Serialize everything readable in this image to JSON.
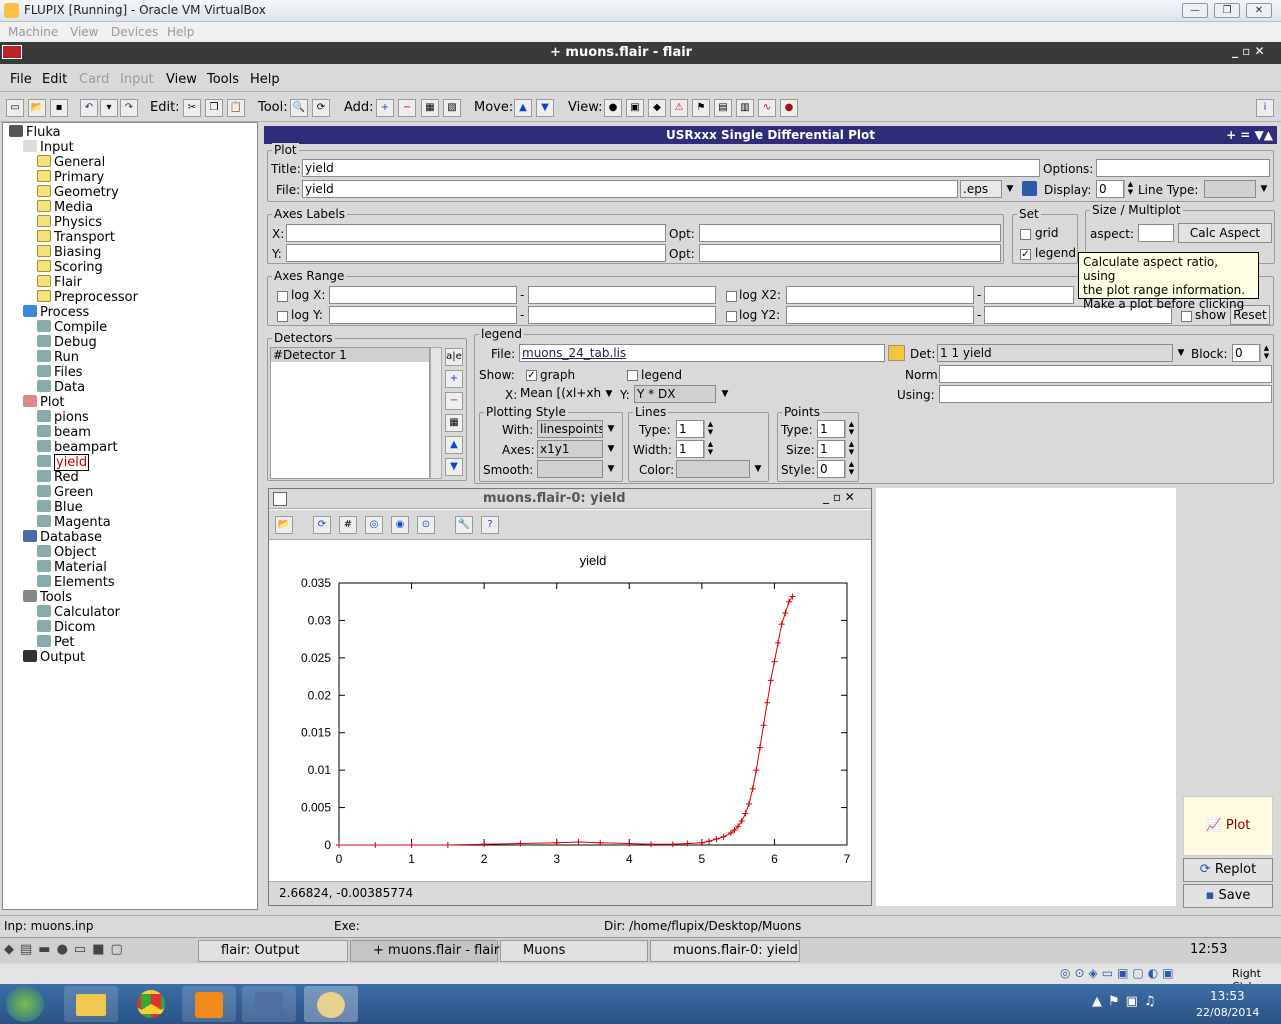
{
  "host": {
    "title": "FLUPIX [Running] - Oracle VM VirtualBox",
    "menu": [
      "Machine",
      "View",
      "Devices",
      "Help"
    ]
  },
  "flair": {
    "title": "+ muons.flair - flair",
    "menu": [
      "File",
      "Edit",
      "Card",
      "Input",
      "View",
      "Tools",
      "Help"
    ],
    "toolbar": {
      "edit": "Edit:",
      "tool": "Tool:",
      "add": "Add:",
      "move": "Move:",
      "view": "View:"
    }
  },
  "tree": {
    "items": [
      {
        "label": "Fluka",
        "indent": 0
      },
      {
        "label": "Input",
        "indent": 1
      },
      {
        "label": "General",
        "indent": 2
      },
      {
        "label": "Primary",
        "indent": 2
      },
      {
        "label": "Geometry",
        "indent": 2
      },
      {
        "label": "Media",
        "indent": 2
      },
      {
        "label": "Physics",
        "indent": 2
      },
      {
        "label": "Transport",
        "indent": 2
      },
      {
        "label": "Biasing",
        "indent": 2
      },
      {
        "label": "Scoring",
        "indent": 2
      },
      {
        "label": "Flair",
        "indent": 2
      },
      {
        "label": "Preprocessor",
        "indent": 2
      },
      {
        "label": "Process",
        "indent": 1
      },
      {
        "label": "Compile",
        "indent": 2
      },
      {
        "label": "Debug",
        "indent": 2
      },
      {
        "label": "Run",
        "indent": 2
      },
      {
        "label": "Files",
        "indent": 2
      },
      {
        "label": "Data",
        "indent": 2
      },
      {
        "label": "Plot",
        "indent": 1
      },
      {
        "label": "pions",
        "indent": 2
      },
      {
        "label": "beam",
        "indent": 2
      },
      {
        "label": "beampart",
        "indent": 2
      },
      {
        "label": "yield",
        "indent": 2
      },
      {
        "label": "Red",
        "indent": 2
      },
      {
        "label": "Green",
        "indent": 2
      },
      {
        "label": "Blue",
        "indent": 2
      },
      {
        "label": "Magenta",
        "indent": 2
      },
      {
        "label": "Database",
        "indent": 1
      },
      {
        "label": "Object",
        "indent": 2
      },
      {
        "label": "Material",
        "indent": 2
      },
      {
        "label": "Elements",
        "indent": 2
      },
      {
        "label": "Tools",
        "indent": 1
      },
      {
        "label": "Calculator",
        "indent": 2
      },
      {
        "label": "Dicom",
        "indent": 2
      },
      {
        "label": "Pet",
        "indent": 2
      },
      {
        "label": "Output",
        "indent": 1
      }
    ]
  },
  "panel": {
    "header": "USRxxx Single Differential Plot",
    "header_ctrls": "+ = ▼▲",
    "plot": {
      "legend": "Plot",
      "title_label": "Title:",
      "title": "yield",
      "options_label": "Options:",
      "file_label": "File:",
      "file": "yield",
      "ext": ".eps",
      "display_label": "Display:",
      "display": "0",
      "linetype_label": "Line Type:"
    },
    "axes_labels": {
      "legend": "Axes Labels",
      "x": "X:",
      "y": "Y:",
      "opt": "Opt:"
    },
    "set": {
      "legend": "Set",
      "grid": "grid",
      "legend_chk": "legend"
    },
    "size": {
      "legend": "Size / Multiplot",
      "aspect": "aspect:",
      "calc": "Calc Aspect"
    },
    "tooltip": [
      "Calculate aspect ratio, using",
      "the plot range information.",
      "Make a plot before clicking"
    ],
    "range": {
      "legend": "Axes Range",
      "logx": "log X:",
      "logy": "log Y:",
      "logx2": "log X2:",
      "logy2": "log Y2:",
      "dash": "-",
      "show": "show",
      "reset": "Reset"
    },
    "detectors": {
      "legend": "Detectors",
      "item": "#Detector 1"
    },
    "info": {
      "legend": "legend",
      "file_label": "File:",
      "file": "muons_24_tab.lis",
      "det_label": "Det:",
      "det": "1 1  yield",
      "block_label": "Block:",
      "block": "0",
      "show": "Show:",
      "graph": "graph",
      "norm": "Norm:",
      "using": "Using:",
      "x_label": "X:",
      "x": "Mean [(xl+xh",
      "y_label": "Y:",
      "y": "Y * DX"
    },
    "style": {
      "legend": "Plotting Style",
      "with": "With:",
      "with_val": "linespoints",
      "axes": "Axes:",
      "axes_val": "x1y1",
      "smooth": "Smooth:"
    },
    "lines": {
      "legend": "Lines",
      "type": "Type:",
      "type_val": "1",
      "width": "Width:",
      "width_val": "1",
      "color": "Color:"
    },
    "points": {
      "legend": "Points",
      "type": "Type:",
      "type_val": "1",
      "size": "Size:",
      "size_val": "1",
      "style": "Style:",
      "style_val": "0"
    },
    "buttons": {
      "plot": "Plot",
      "replot": "Replot",
      "save": "Save"
    }
  },
  "plotwin": {
    "title": "muons.flair-0: yield",
    "coords": "2.66824, -0.00385774"
  },
  "chart_data": {
    "type": "line",
    "title": "yield",
    "xlabel": "",
    "ylabel": "",
    "xlim": [
      0,
      7
    ],
    "ylim": [
      0,
      0.035
    ],
    "xticks": [
      "0",
      "1",
      "2",
      "3",
      "4",
      "5",
      "6",
      "7"
    ],
    "yticks": [
      "0",
      "0.005",
      "0.01",
      "0.015",
      "0.02",
      "0.025",
      "0.03",
      "0.035"
    ],
    "color": "#d40000",
    "series": [
      {
        "x": [
          0,
          0.5,
          1,
          1.5,
          2,
          2.5,
          3,
          3.3,
          3.6,
          4,
          4.3,
          4.6,
          4.8,
          5,
          5.1,
          5.2,
          5.3,
          5.4,
          5.45,
          5.5,
          5.55,
          5.6,
          5.65,
          5.7,
          5.75,
          5.8,
          5.85,
          5.9,
          5.95,
          6,
          6.05,
          6.1,
          6.15,
          6.2,
          6.25
        ],
        "y": [
          0,
          0,
          0,
          0,
          0.0001,
          0.0002,
          0.0003,
          0.0004,
          0.0003,
          0.0002,
          0.0001,
          0.0001,
          0.0002,
          0.0003,
          0.0005,
          0.0008,
          0.0011,
          0.0016,
          0.002,
          0.0025,
          0.0032,
          0.0042,
          0.0055,
          0.0075,
          0.01,
          0.013,
          0.016,
          0.019,
          0.022,
          0.0245,
          0.027,
          0.0295,
          0.031,
          0.0325,
          0.0332
        ]
      }
    ]
  },
  "status": {
    "inp": "Inp: muons.inp",
    "exe": "Exe:",
    "dir": "Dir: /home/flupix/Desktop/Muons"
  },
  "taskbar": {
    "tasks": [
      "flair: Output",
      "+ muons.flair - flair",
      "Muons",
      "muons.flair-0: yield"
    ],
    "time": "12:53"
  },
  "tray": {
    "rightctrl": "Right Ctrl"
  },
  "win7": {
    "time": "13:53",
    "date": "22/08/2014"
  }
}
